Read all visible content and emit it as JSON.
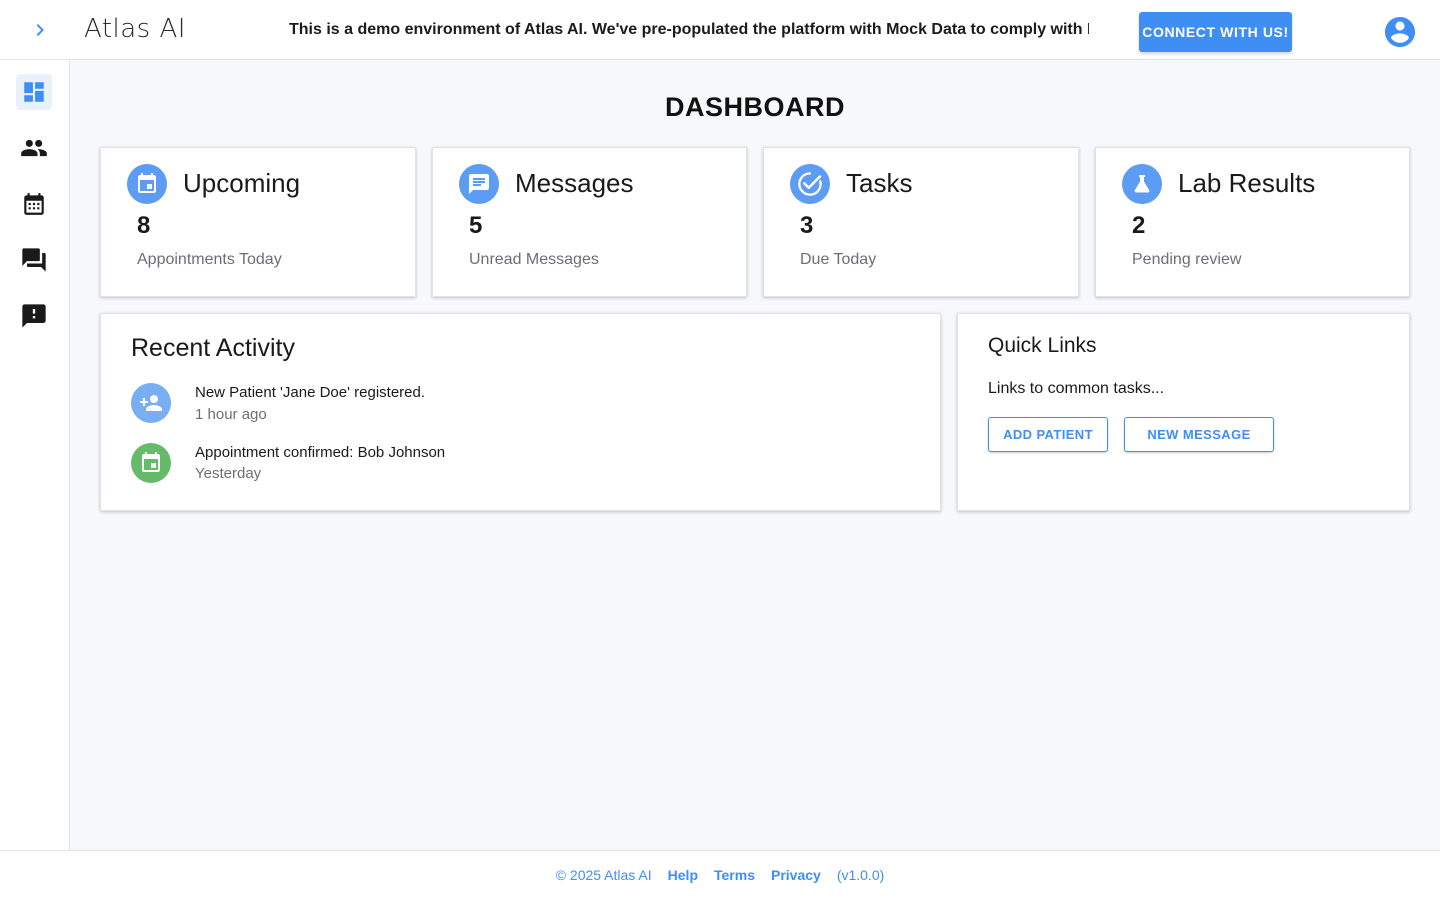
{
  "header": {
    "logo": "Atlas AI",
    "banner": "This is a demo environment of Atlas AI. We've pre-populated the platform with Mock Data to comply with HIPAA",
    "connect_label": "CONNECT WITH US!",
    "expand_icon": "chevron-right-icon",
    "account_icon": "account-circle-icon"
  },
  "sidebar": {
    "items": [
      {
        "name": "dashboard",
        "icon": "dashboard-icon",
        "active": true
      },
      {
        "name": "patients",
        "icon": "people-icon",
        "active": false
      },
      {
        "name": "calendar",
        "icon": "calendar-icon",
        "active": false
      },
      {
        "name": "messages",
        "icon": "forum-icon",
        "active": false
      },
      {
        "name": "feedback",
        "icon": "feedback-icon",
        "active": false
      }
    ]
  },
  "page_title": "DASHBOARD",
  "stats": [
    {
      "title": "Upcoming",
      "value": "8",
      "label": "Appointments Today",
      "icon": "event-icon"
    },
    {
      "title": "Messages",
      "value": "5",
      "label": "Unread Messages",
      "icon": "message-icon"
    },
    {
      "title": "Tasks",
      "value": "3",
      "label": "Due Today",
      "icon": "task-check-icon"
    },
    {
      "title": "Lab Results",
      "value": "2",
      "label": "Pending review",
      "icon": "flask-icon"
    }
  ],
  "activity": {
    "title": "Recent Activity",
    "items": [
      {
        "text": "New Patient 'Jane Doe' registered.",
        "time": "1 hour ago",
        "icon": "person-add-icon",
        "color": "#78aef2"
      },
      {
        "text": "Appointment confirmed: Bob Johnson",
        "time": "Yesterday",
        "icon": "event-icon",
        "color": "#66bb6a"
      }
    ]
  },
  "quick_links": {
    "title": "Quick Links",
    "description": "Links to common tasks...",
    "add_patient": "ADD PATIENT",
    "new_message": "NEW MESSAGE"
  },
  "footer": {
    "copyright": "© 2025 Atlas AI",
    "help": "Help",
    "terms": "Terms",
    "privacy": "Privacy",
    "version": "(v1.0.0)"
  },
  "colors": {
    "accent": "#3f8ef3",
    "icon_blue": "#5c9cf2",
    "success": "#66bb6a"
  }
}
